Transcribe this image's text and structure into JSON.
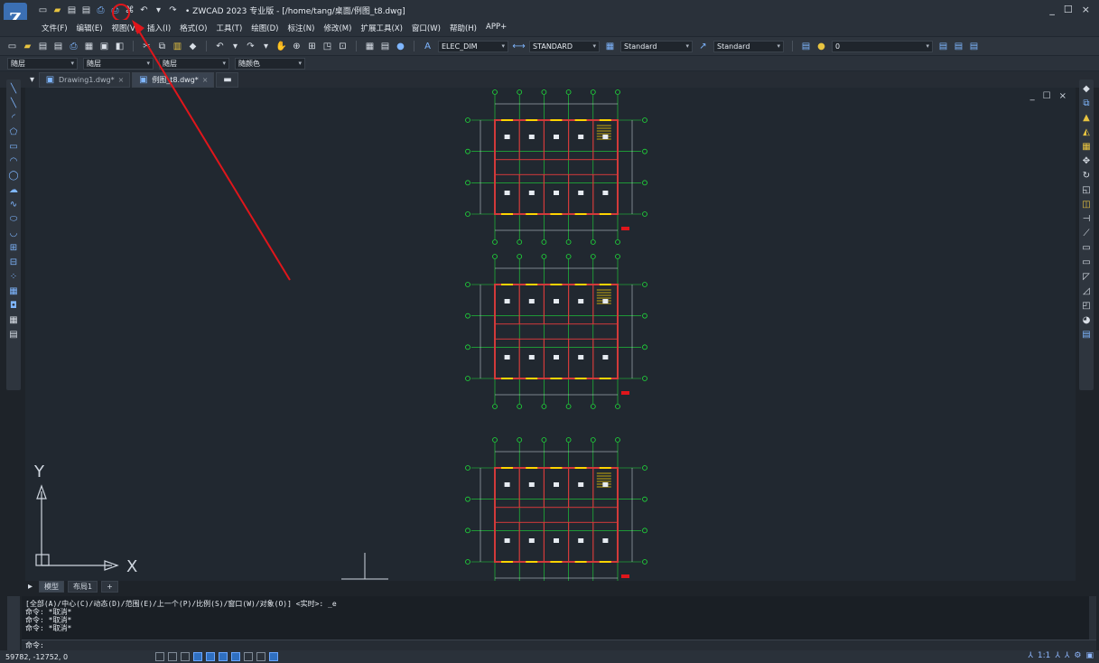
{
  "window": {
    "title": "• ZWCAD 2023 专业版 - [/home/tang/桌面/例图_t8.dwg]",
    "logo_text": "Z",
    "controls": [
      "_",
      "☐",
      "×"
    ]
  },
  "menu": {
    "items": [
      "文件(F)",
      "编辑(E)",
      "视图(V)",
      "插入(I)",
      "格式(O)",
      "工具(T)",
      "绘图(D)",
      "标注(N)",
      "修改(M)",
      "扩展工具(X)",
      "窗口(W)",
      "帮助(H)",
      "APP+"
    ]
  },
  "toolbar": {
    "text_style": "ELEC_DIM",
    "dim_style": "STANDARD",
    "table_style": "Standard",
    "multileader_style": "Standard",
    "layer": "0"
  },
  "properties": {
    "color": "随层",
    "linetype": "随层",
    "lineweight": "随层",
    "plotstyle": "随颜色"
  },
  "tabs": [
    {
      "label": "Drawing1.dwg*",
      "active": false
    },
    {
      "label": "例图_t8.dwg*",
      "active": true
    }
  ],
  "viewport_controls": [
    "_",
    "☐",
    "×"
  ],
  "ucs": {
    "x_label": "X",
    "y_label": "Y"
  },
  "layout_tabs": [
    {
      "label": "模型",
      "active": true
    },
    {
      "label": "布局1",
      "active": false
    },
    {
      "label": "+",
      "active": false
    }
  ],
  "command": {
    "history": [
      "[全部(A)/中心(C)/动态(D)/范围(E)/上一个(P)/比例(S)/窗口(W)/对象(O)] <实时>: _e",
      "命令: *取消*",
      "命令: *取消*",
      "命令: *取消*"
    ],
    "prompt": "命令:"
  },
  "status": {
    "coords": "59782, -12752, 0",
    "scale": "1:1"
  },
  "colors": {
    "annotation": "#e0161b",
    "wall": "#d23a3a",
    "axis": "#1fdc3a",
    "highlight": "#ffd400"
  }
}
